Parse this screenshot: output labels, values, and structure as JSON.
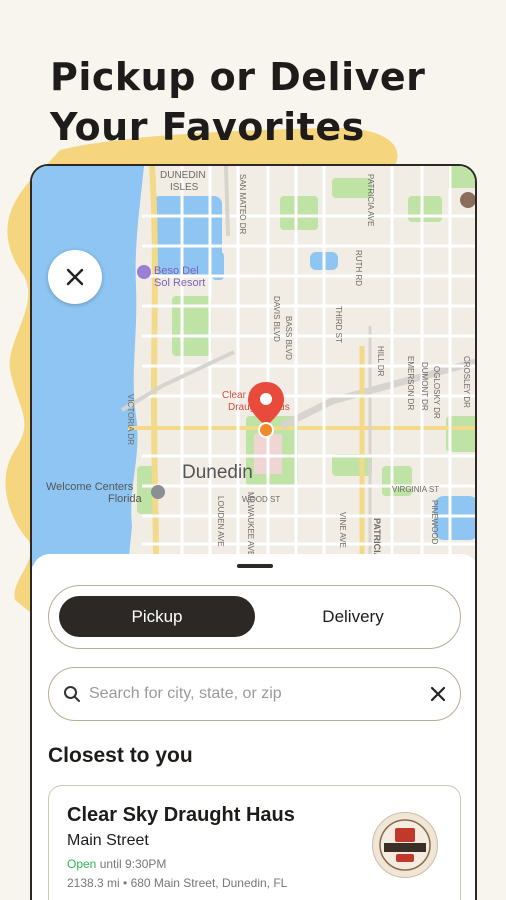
{
  "headline": {
    "line1": "Pickup or Deliver",
    "line2": "Your Favorites"
  },
  "colors": {
    "accent_yellow": "#f5d57e",
    "dark": "#2b2825",
    "water": "#8ec5f2",
    "park": "#bfe3a4",
    "pin_red": "#e84b3c",
    "open_green": "#2eb851"
  },
  "map": {
    "labels": {
      "dunedin_isles_1": "DUNEDIN",
      "dunedin_isles_2": "ISLES",
      "san_mateo": "SAN MATEO DR",
      "patricia": "PATRICIA AVE",
      "ruth": "RUTH RD",
      "beso1": "Beso Del",
      "beso2": "Sol Resort",
      "davis": "DAVIS BLVD",
      "bass": "BASS BLVD",
      "third": "THIRD ST",
      "hill": "HILL DR",
      "emerson": "EMERSON DR",
      "dumont": "DUMONT DR",
      "glosky": "OGLOSKY DR",
      "crosley": "CROSLEY DR",
      "pin_label1": "Clear Sky",
      "pin_label2": "Draught Haus",
      "victoria": "VICTORIA DR",
      "city": "Dunedin",
      "welcome1": "Welcome Centers",
      "welcome2": "Florida",
      "wood": "WOOD ST",
      "virginia": "VIRGINIA ST",
      "louden": "LOUDEN AVE",
      "milwaukee": "MILWAUKEE AVE",
      "vine": "VINE AVE",
      "patricia2": "PATRICIA",
      "pinewood": "PINEWOOD"
    },
    "close_icon": "close-icon"
  },
  "sheet": {
    "toggle": {
      "pickup": "Pickup",
      "delivery": "Delivery",
      "selected": "Pickup"
    },
    "search": {
      "placeholder": "Search for city, state, or zip",
      "value": ""
    },
    "section_title": "Closest to you",
    "location": {
      "name": "Clear Sky Draught Haus",
      "street": "Main Street",
      "status": "Open",
      "hours": "until 9:30PM",
      "distance_address": "2138.3 mi • 680 Main Street, Dunedin, FL"
    }
  }
}
